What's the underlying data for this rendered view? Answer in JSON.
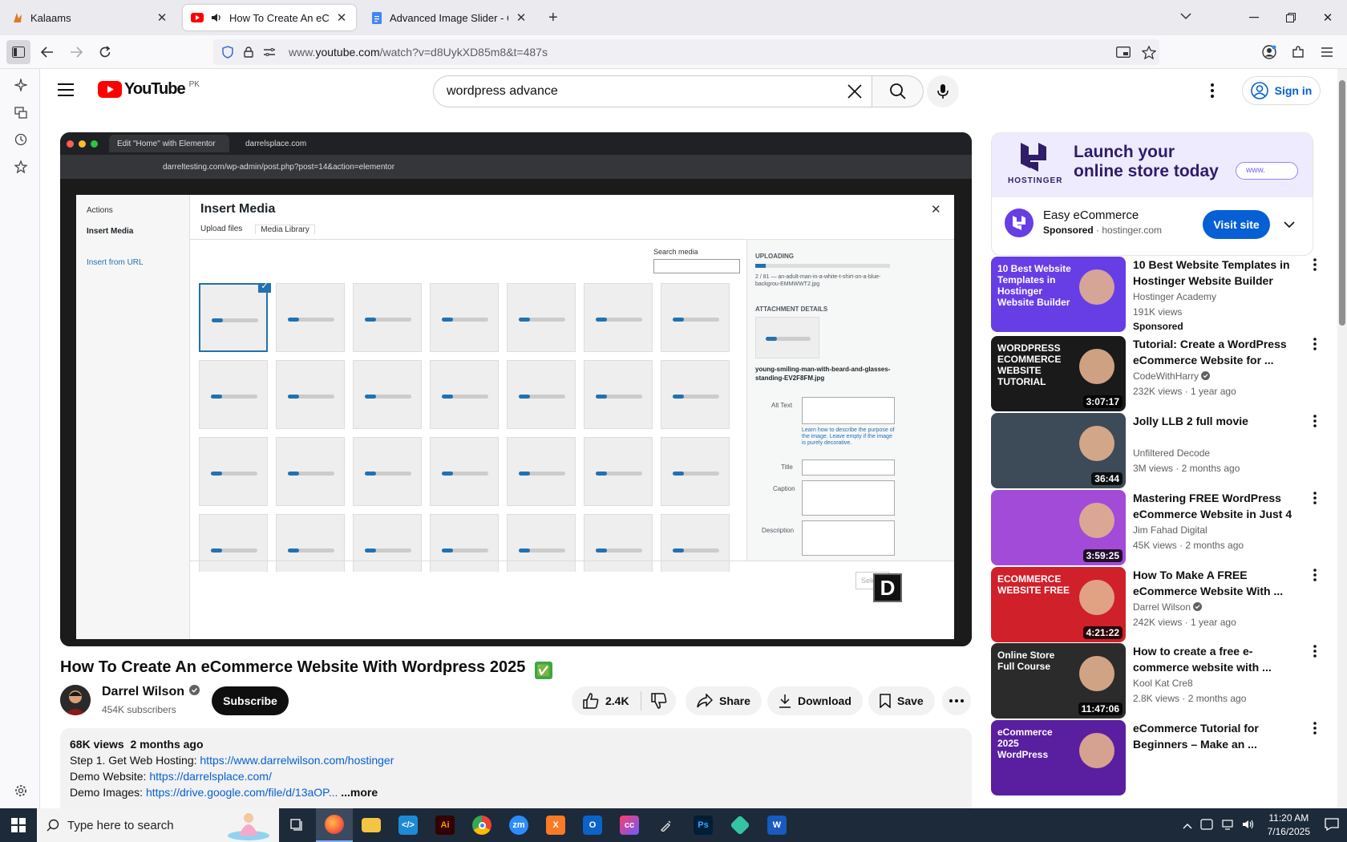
{
  "browser": {
    "tabs": [
      {
        "title": "Kalaams",
        "active": false
      },
      {
        "title": "How To Create An eComme",
        "active": true
      },
      {
        "title": "Advanced Image Slider - Code",
        "active": false
      }
    ],
    "url_prefix": "www.",
    "url_domain": "youtube.com",
    "url_path": "/watch?v=d8UykXD85m8&t=487s"
  },
  "youtube": {
    "logo_text": "YouTube",
    "region": "PK",
    "search_value": "wordpress advance",
    "signin_label": "Sign in"
  },
  "video_frame": {
    "inner_tab1": "Edit \"Home\" with Elementor",
    "inner_tab2": "darrelsplace.com",
    "inner_url": "darreltesting.com/wp-admin/post.php?post=14&action=elementor",
    "modal_title": "Insert Media",
    "actions_label": "Actions",
    "side_insert_media": "Insert Media",
    "side_insert_url": "Insert from URL",
    "tab_upload": "Upload files",
    "tab_library": "Media Library",
    "search_media_label": "Search media",
    "uploading_label": "UPLOADING",
    "uploading_file": "2 / 81 — an-adult-man-in-a-white-t-shirt-on-a-blue-backgrou-EMMWWT2.jpg",
    "attachment_details": "ATTACHMENT DETAILS",
    "attachment_file": "young-smiling-man-with-beard-and-glasses-standing-EV2F8FM.jpg",
    "alt_text_label": "Alt Text",
    "alt_help": "Learn how to describe the purpose of the image. Leave empty if the image is purely decorative.",
    "title_label": "Title",
    "caption_label": "Caption",
    "description_label": "Description",
    "select_btn": "Sele"
  },
  "video": {
    "title": "How To Create An eCommerce Website With Wordpress 2025",
    "title_emoji": "✅",
    "channel": "Darrel Wilson",
    "subscribers": "454K subscribers",
    "subscribe_label": "Subscribe",
    "likes": "2.4K",
    "share_label": "Share",
    "download_label": "Download",
    "save_label": "Save",
    "views": "68K views",
    "age": "2 months ago",
    "desc_line1_text": "Step 1. Get Web Hosting: ",
    "desc_line1_link": "https://www.darrelwilson.com/hostinger",
    "desc_line2_text": "Demo Website: ",
    "desc_line2_link": "https://darrelsplace.com/",
    "desc_line3_text": "Demo Images: ",
    "desc_line3_link": "https://drive.google.com/file/d/13aOP...",
    "more_label": "...more"
  },
  "ad": {
    "brand": "HOSTINGER",
    "headline1": "Launch your",
    "headline2": "online store today",
    "www": "www.",
    "title": "Easy eCommerce",
    "sponsored": "Sponsored",
    "domain": "hostinger.com",
    "cta": "Visit site"
  },
  "recommendations": [
    {
      "title": "10 Best Website Templates in Hostinger Website Builder",
      "channel": "Hostinger Academy",
      "meta": "191K views",
      "extra": "Sponsored",
      "duration": "",
      "verified": false,
      "thumb_text": "10 Best Website Templates in Hostinger Website Builder",
      "thumb_color": "#673de6"
    },
    {
      "title": "Tutorial: Create a WordPress eCommerce Website for ...",
      "channel": "CodeWithHarry",
      "meta": "232K views · 1 year ago",
      "extra": "",
      "duration": "3:07:17",
      "verified": true,
      "thumb_text": "WORDPRESS ECOMMERCE WEBSITE TUTORIAL",
      "thumb_color": "#1a1a1a"
    },
    {
      "title": "Jolly LLB 2 full movie",
      "channel": "Unfiltered Decode",
      "meta": "3M views · 2 months ago",
      "extra": "",
      "duration": "36:44",
      "verified": false,
      "thumb_text": "",
      "thumb_color": "#3d4a57"
    },
    {
      "title": "Mastering FREE WordPress eCommerce Website in Just 4 ...",
      "channel": "Jim Fahad Digital",
      "meta": "45K views · 2 months ago",
      "extra": "",
      "duration": "3:59:25",
      "verified": false,
      "thumb_text": "",
      "thumb_color": "#a24bd8"
    },
    {
      "title": "How To Make A FREE eCommerce Website With ...",
      "channel": "Darrel Wilson",
      "meta": "242K views · 1 year ago",
      "extra": "",
      "duration": "4:21:22",
      "verified": true,
      "thumb_text": "ECOMMERCE WEBSITE FREE",
      "thumb_color": "#d0202a"
    },
    {
      "title": "How to create a free e-commerce website with ...",
      "channel": "Kool Kat Cre8",
      "meta": "2.8K views · 2 months ago",
      "extra": "",
      "duration": "11:47:06",
      "verified": false,
      "thumb_text": "Online Store Full Course",
      "thumb_color": "#2b2b2b"
    },
    {
      "title": "eCommerce Tutorial for Beginners – Make an ...",
      "channel": "",
      "meta": "",
      "extra": "",
      "duration": "",
      "verified": false,
      "thumb_text": "eCommerce 2025 WordPress",
      "thumb_color": "#5a1fa0"
    }
  ],
  "taskbar": {
    "search_placeholder": "Type here to search",
    "time": "11:20 AM",
    "date": "7/16/2025"
  }
}
